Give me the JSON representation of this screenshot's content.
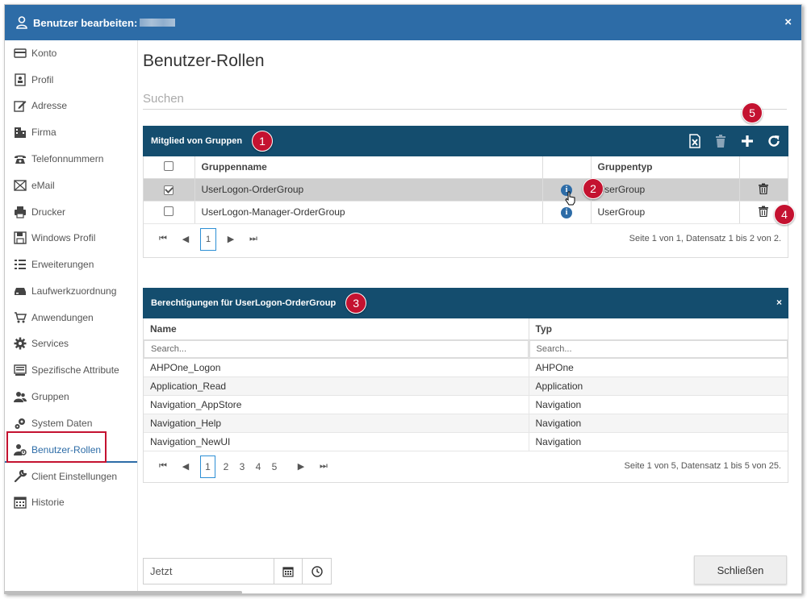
{
  "dialog": {
    "title": "Benutzer bearbeiten:",
    "close_label": "×"
  },
  "sidebar": {
    "items": [
      {
        "label": "Konto",
        "icon": "credit-card-icon"
      },
      {
        "label": "Profil",
        "icon": "profile-card-icon"
      },
      {
        "label": "Adresse",
        "icon": "edit-icon"
      },
      {
        "label": "Firma",
        "icon": "building-icon"
      },
      {
        "label": "Telefonnummern",
        "icon": "phone-icon"
      },
      {
        "label": "eMail",
        "icon": "envelope-icon"
      },
      {
        "label": "Drucker",
        "icon": "printer-icon"
      },
      {
        "label": "Windows Profil",
        "icon": "floppy-icon"
      },
      {
        "label": "Erweiterungen",
        "icon": "list-icon"
      },
      {
        "label": "Laufwerkzuordnung",
        "icon": "drive-icon"
      },
      {
        "label": "Anwendungen",
        "icon": "cart-icon"
      },
      {
        "label": "Services",
        "icon": "gear-icon"
      },
      {
        "label": "Spezifische Attribute",
        "icon": "stack-icon"
      },
      {
        "label": "Gruppen",
        "icon": "users-icon"
      },
      {
        "label": "System Daten",
        "icon": "gears-icon"
      },
      {
        "label": "Benutzer-Rollen",
        "icon": "user-role-icon",
        "active": true
      },
      {
        "label": "Client Einstellungen",
        "icon": "wrench-icon"
      },
      {
        "label": "Historie",
        "icon": "calendar-icon"
      }
    ]
  },
  "main": {
    "title": "Benutzer-Rollen",
    "search_placeholder": "Suchen"
  },
  "groups_panel": {
    "title": "Mitglied von Gruppen",
    "badge": "1",
    "toolbar_badge": "5",
    "columns": [
      "Gruppenname",
      "",
      "Gruppentyp",
      ""
    ],
    "rows": [
      {
        "name": "UserLogon-OrderGroup",
        "type": "UserGroup",
        "checked": true,
        "badge_info": "2"
      },
      {
        "name": "UserLogon-Manager-OrderGroup",
        "type": "UserGroup",
        "checked": false,
        "badge_delete": "4"
      }
    ],
    "pager": {
      "first": "⏮",
      "prev": "◀",
      "next": "▶",
      "last": "⏭",
      "pages": [
        "1"
      ],
      "current": "1",
      "info_text": "Seite 1 von 1, Datensatz 1 bis 2 von 2."
    }
  },
  "permissions_panel": {
    "title": "Berechtigungen für UserLogon-OrderGroup",
    "badge": "3",
    "close_label": "×",
    "columns": [
      "Name",
      "Typ"
    ],
    "filter_placeholders": [
      "Search...",
      "Search..."
    ],
    "rows": [
      {
        "name": "AHPOne_Logon",
        "type": "AHPOne"
      },
      {
        "name": "Application_Read",
        "type": "Application"
      },
      {
        "name": "Navigation_AppStore",
        "type": "Navigation"
      },
      {
        "name": "Navigation_Help",
        "type": "Navigation"
      },
      {
        "name": "Navigation_NewUI",
        "type": "Navigation"
      }
    ],
    "pager": {
      "pages": [
        "1",
        "2",
        "3",
        "4",
        "5"
      ],
      "current": "1",
      "info_text": "Seite 1 von 5, Datensatz 1 bis 5 von 25."
    }
  },
  "footer": {
    "date_value": "Jetzt",
    "close_button": "Schließen"
  },
  "colors": {
    "titlebar": "#2d6ca7",
    "panel_header": "#144d6e",
    "badge": "#c41230",
    "active": "#2d6ca7"
  }
}
